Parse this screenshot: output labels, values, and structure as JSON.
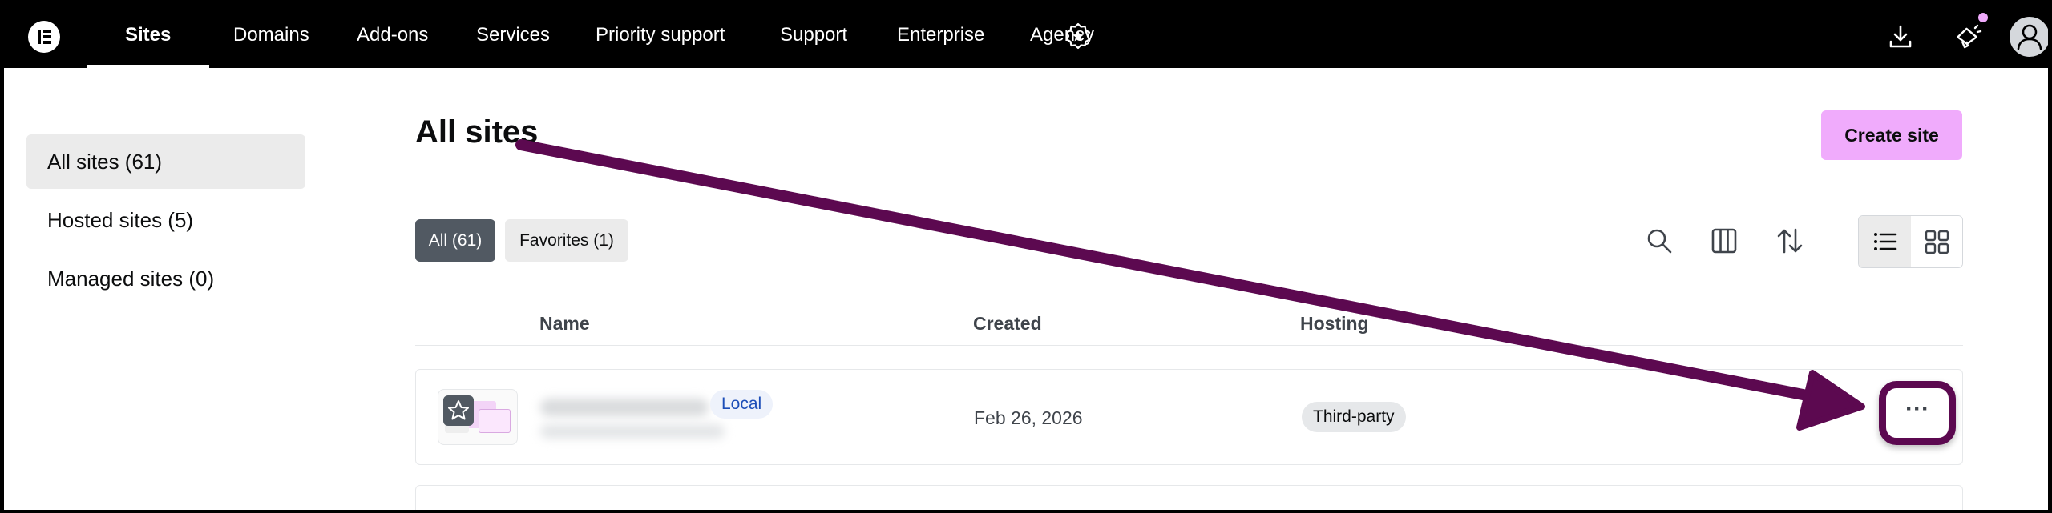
{
  "nav": {
    "items": [
      {
        "label": "Sites",
        "active": true
      },
      {
        "label": "Domains"
      },
      {
        "label": "Add-ons"
      },
      {
        "label": "Services"
      },
      {
        "label": "Priority support"
      },
      {
        "label": "Support"
      },
      {
        "label": "Enterprise"
      },
      {
        "label": "Agency"
      }
    ],
    "icons": [
      "download-icon",
      "megaphone-icon",
      "user-icon"
    ],
    "notification_color": "#f0abfc"
  },
  "sidebar": {
    "items": [
      {
        "label": "All sites (61)",
        "active": true
      },
      {
        "label": "Hosted sites (5)"
      },
      {
        "label": "Managed sites (0)"
      }
    ]
  },
  "main": {
    "title": "All sites",
    "create_label": "Create site",
    "filters": [
      {
        "label": "All (61)",
        "active": true
      },
      {
        "label": "Favorites (1)"
      }
    ],
    "toolbar_icons": [
      "search-icon",
      "columns-icon",
      "sort-icon",
      "list-view-icon",
      "grid-view-icon"
    ],
    "table": {
      "headers": [
        "Name",
        "Created",
        "Hosting"
      ],
      "rows": [
        {
          "badge": "Local",
          "created": "Feb 26, 2026",
          "hosting": "Third-party",
          "actions": "···"
        }
      ]
    }
  },
  "colors": {
    "accent": "#f0abfc",
    "annotation": "#5c0950",
    "nav_bg": "#000000"
  }
}
